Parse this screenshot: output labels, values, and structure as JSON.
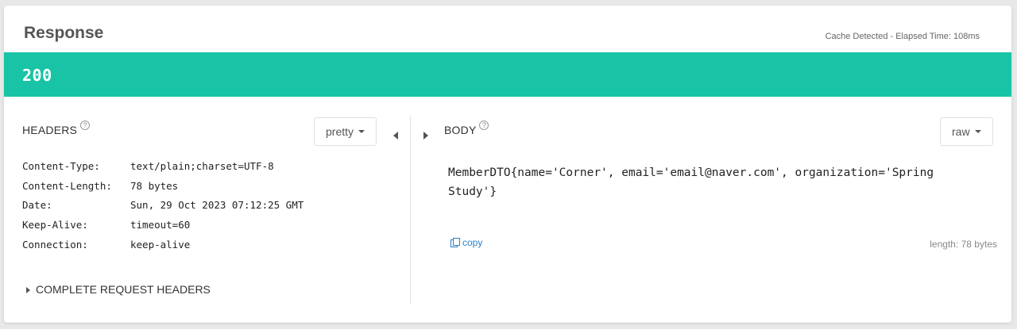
{
  "response": {
    "title": "Response",
    "meta": "Cache Detected - Elapsed Time: 108ms",
    "status_code": "200",
    "status_color": "#18c4a5"
  },
  "headers_panel": {
    "title": "HEADERS",
    "help_icon": "help-circle-icon",
    "format_label": "pretty",
    "rows": [
      {
        "key": "Content-Type:",
        "value": "text/plain;charset=UTF-8"
      },
      {
        "key": "Content-Length:",
        "value": "78 bytes"
      },
      {
        "key": "Date:",
        "value": "Sun, 29 Oct 2023 07:12:25 GMT"
      },
      {
        "key": "Keep-Alive:",
        "value": "timeout=60"
      },
      {
        "key": "Connection:",
        "value": "keep-alive"
      }
    ],
    "complete_request_headers_label": "COMPLETE REQUEST HEADERS"
  },
  "body_panel": {
    "title": "BODY",
    "help_icon": "help-circle-icon",
    "format_label": "raw",
    "content": "MemberDTO{name='Corner', email='email@naver.com', organization='Spring Study'}",
    "copy_label": "copy",
    "length_label": "length: 78 bytes"
  },
  "icons": {
    "collapse_left": "triangle-left-icon",
    "collapse_right": "triangle-right-icon",
    "copy": "copy-icon"
  }
}
